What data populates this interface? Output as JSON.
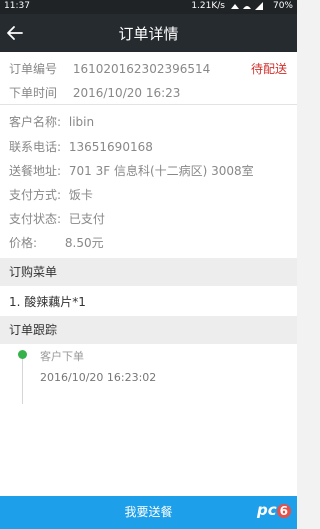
{
  "status_bar": {
    "time": "11:37",
    "network_speed": "1.21K/s",
    "battery": "70%"
  },
  "header": {
    "title": "订单详情"
  },
  "order": {
    "number_label": "订单编号",
    "number_value": "161020162302396514",
    "status": "待配送",
    "time_label": "下单时间",
    "time_value": "2016/10/20 16:23"
  },
  "customer": {
    "name_label": "客户名称:",
    "name_value": "libin",
    "phone_label": "联系电话:",
    "phone_value": "13651690168",
    "address_label": "送餐地址:",
    "address_value": "701 3F 信息科(十二病区) 3008室",
    "payment_method_label": "支付方式:",
    "payment_method_value": "饭卡",
    "payment_status_label": "支付状态:",
    "payment_status_value": "已支付",
    "price_label": "价格:",
    "price_value": "8.50元"
  },
  "menu_section": {
    "header": "订购菜单",
    "items": [
      "1. 酸辣藕片*1"
    ]
  },
  "tracking_section": {
    "header": "订单跟踪",
    "events": [
      {
        "title": "客户下单",
        "time": "2016/10/20 16:23:02"
      }
    ]
  },
  "action": {
    "deliver_label": "我要送餐"
  },
  "colors": {
    "accent": "#1d9fe9",
    "status_red": "#d0312d",
    "timeline_green": "#36b24a",
    "titlebar": "#262b2f"
  }
}
